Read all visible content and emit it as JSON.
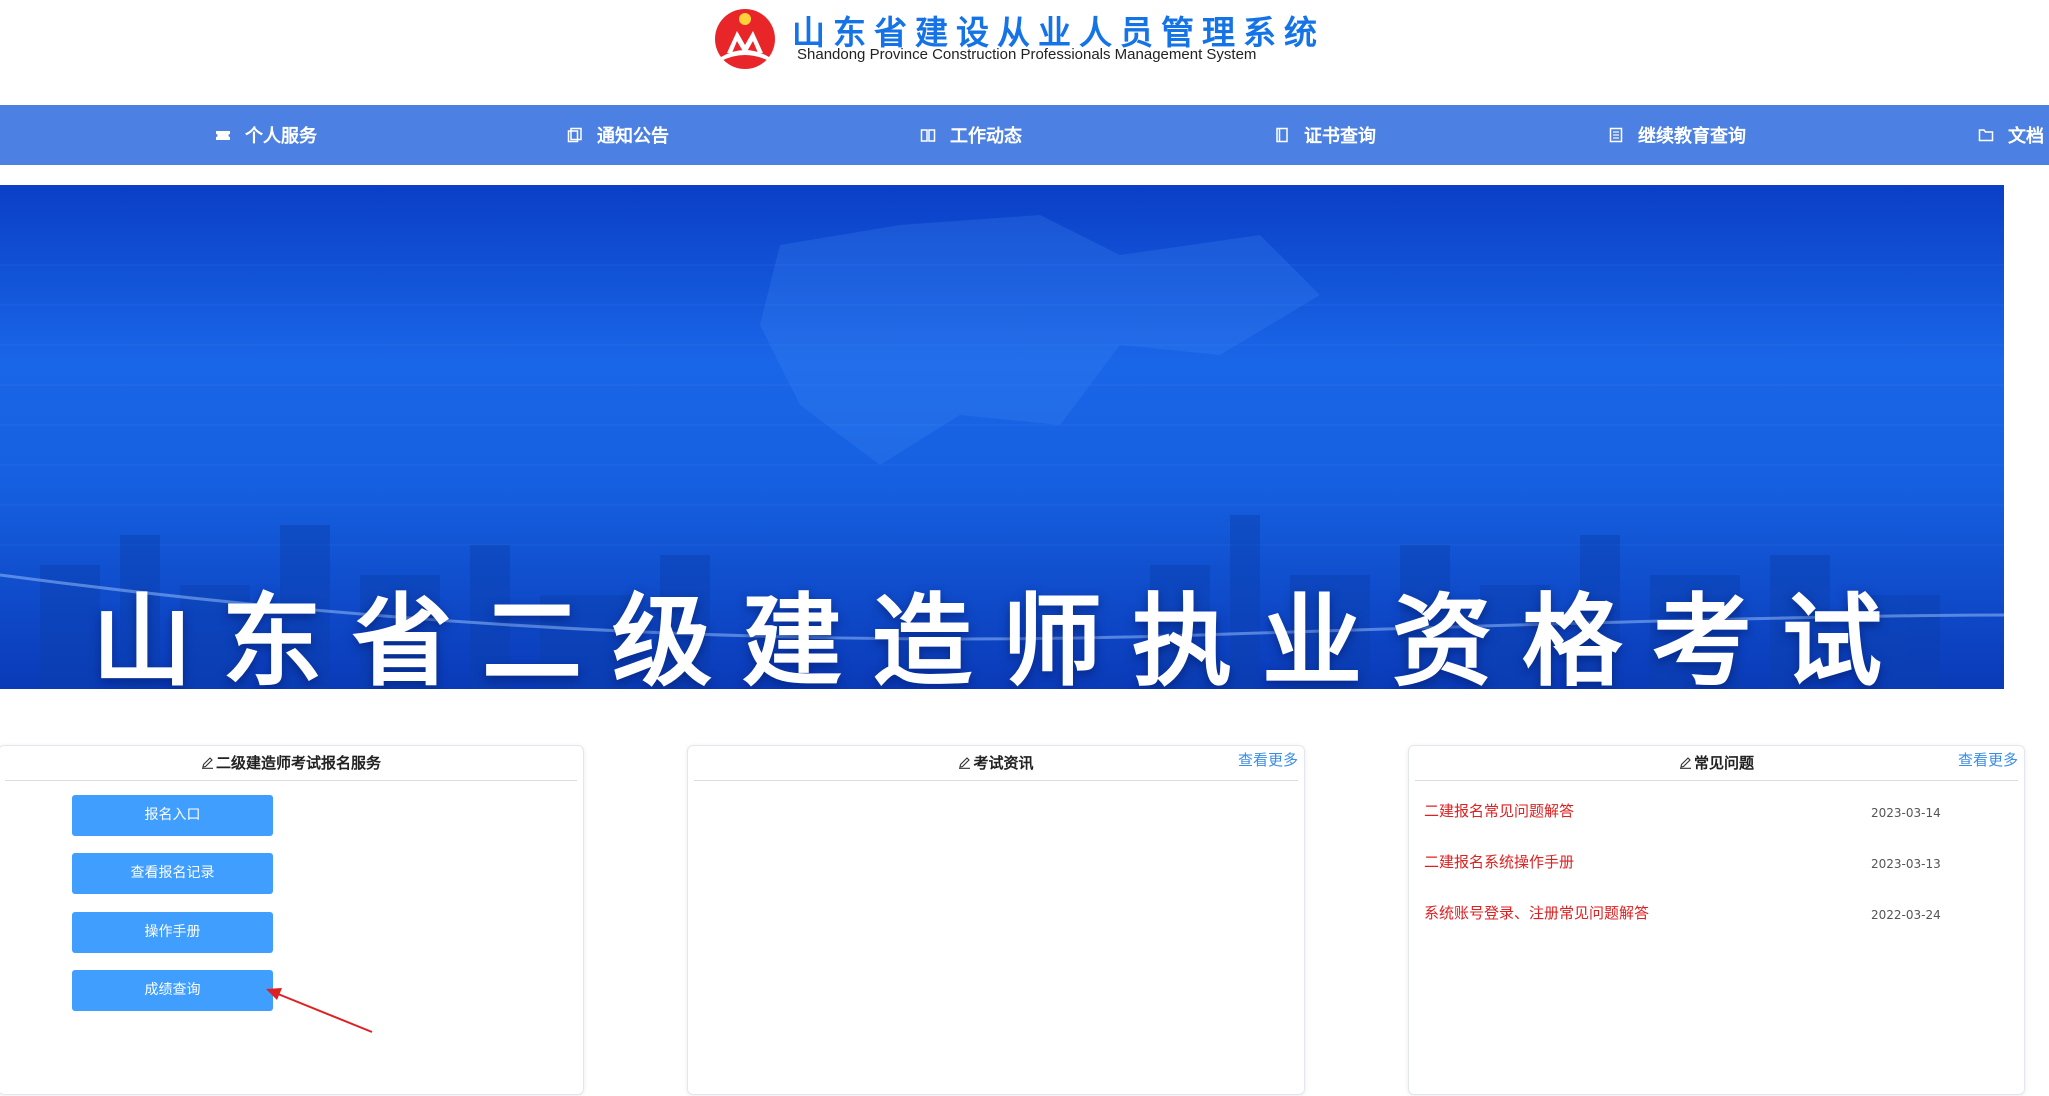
{
  "header": {
    "title_cn": "山东省建设从业人员管理系统",
    "title_en": "Shandong Province Construction Professionals Management System"
  },
  "nav": {
    "items": [
      {
        "label": "个人服务",
        "icon": "ticket-icon"
      },
      {
        "label": "通知公告",
        "icon": "copy-icon"
      },
      {
        "label": "工作动态",
        "icon": "book-open-icon"
      },
      {
        "label": "证书查询",
        "icon": "notebook-icon"
      },
      {
        "label": "继续教育查询",
        "icon": "document-list-icon"
      },
      {
        "label": "文档",
        "icon": "folder-icon"
      }
    ]
  },
  "banner": {
    "title": "山东省二级建造师执业资格考试"
  },
  "exam_service": {
    "title": "二级建造师考试报名服务",
    "buttons": {
      "register": "报名入口",
      "records": "查看报名记录",
      "manual": "操作手册",
      "scores": "成绩查询"
    }
  },
  "exam_news": {
    "title": "考试资讯",
    "more": "查看更多"
  },
  "faq": {
    "title": "常见问题",
    "more": "查看更多",
    "items": [
      {
        "title": "二建报名常见问题解答",
        "date": "2023-03-14"
      },
      {
        "title": "二建报名系统操作手册",
        "date": "2023-03-13"
      },
      {
        "title": "系统账号登录、注册常见问题解答",
        "date": "2022-03-24"
      }
    ]
  },
  "colors": {
    "brand_blue": "#1473e6",
    "nav_bg": "#4d80e3",
    "button_blue": "#409eff",
    "link_red": "#e02020",
    "annotation_arrow": "#e02020"
  }
}
